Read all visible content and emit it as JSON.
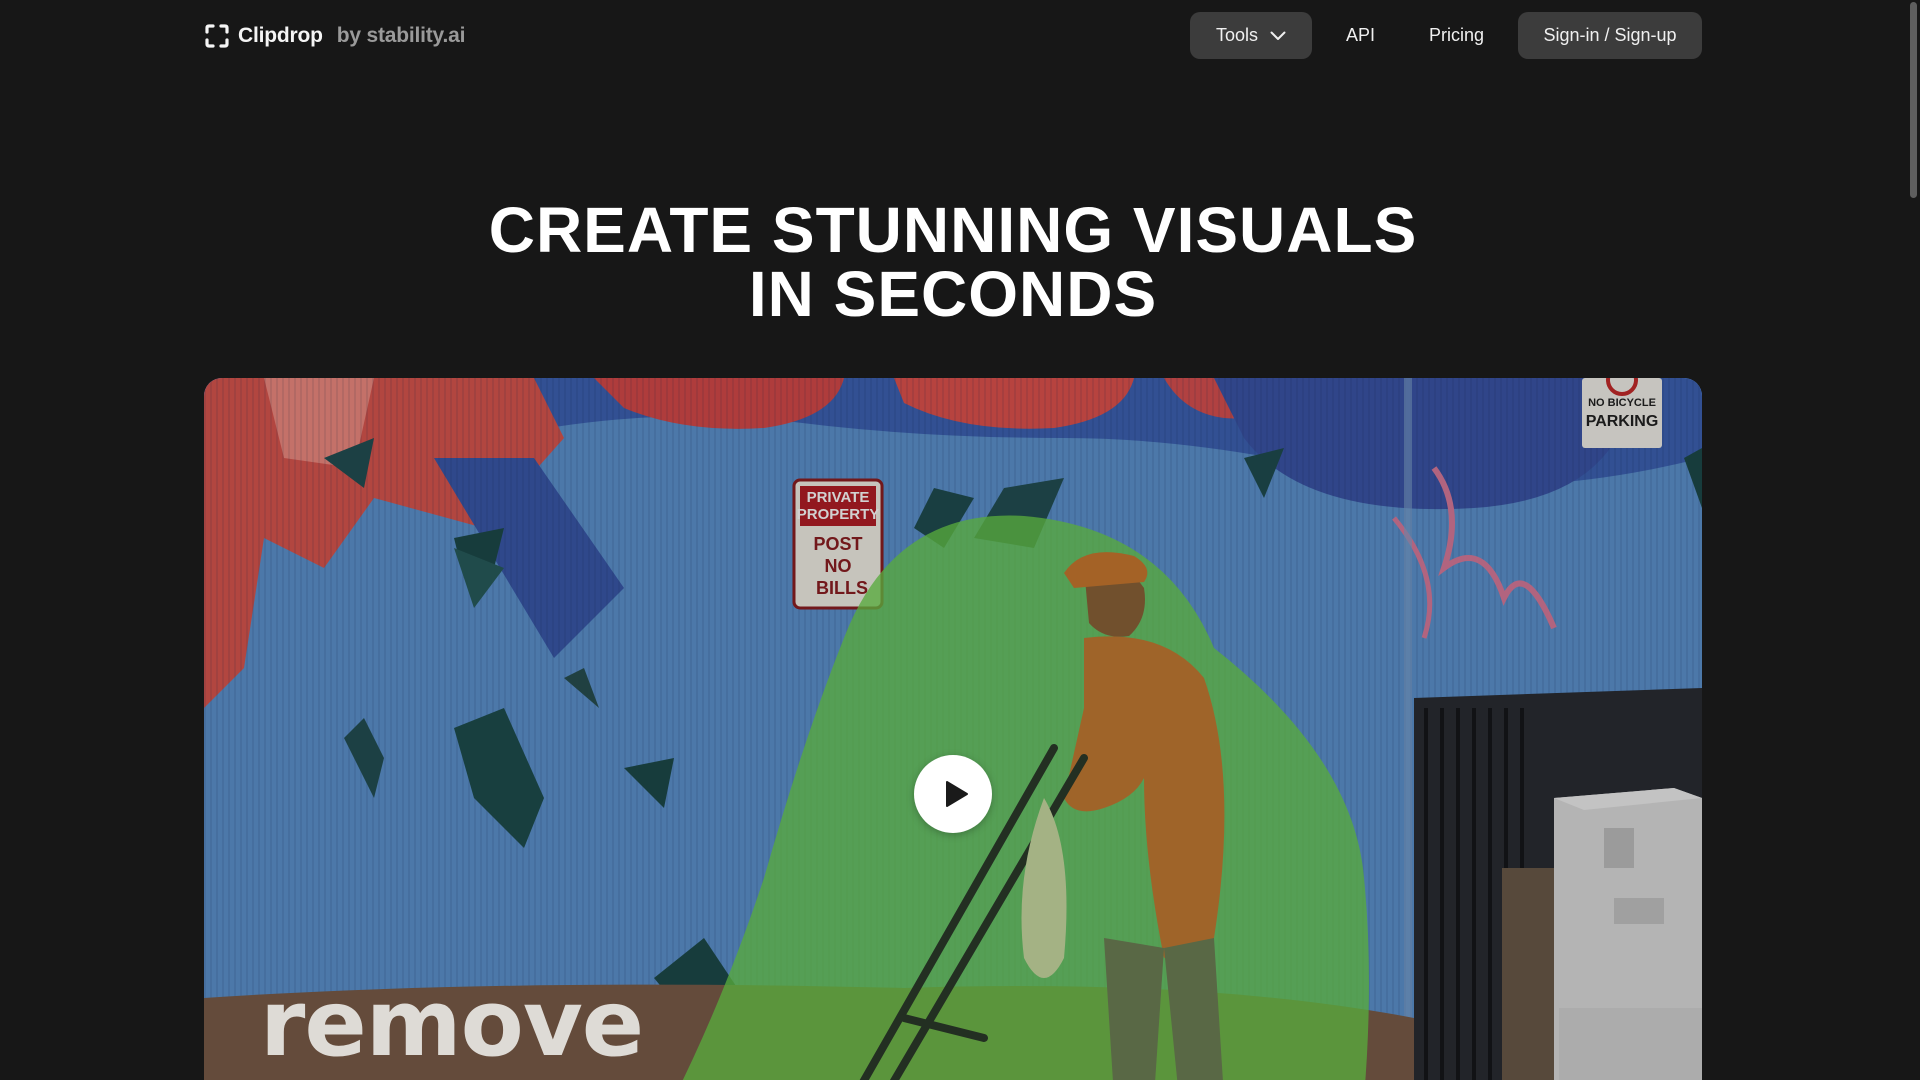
{
  "brand": {
    "name": "Clipdrop",
    "by": "by stability.ai",
    "icon": "clipdrop-logo-icon"
  },
  "nav": {
    "tools_label": "Tools",
    "tools_icon": "chevron-down-icon",
    "api_label": "API",
    "pricing_label": "Pricing",
    "signin_label": "Sign-in / Sign-up"
  },
  "hero": {
    "title_line1": "CREATE STUNNING VISUALS",
    "title_line2": "IN SECONDS"
  },
  "video": {
    "caption": "remove",
    "play_icon": "play-icon",
    "sign_private_line1": "PRIVATE",
    "sign_private_line2": "PROPERTY",
    "sign_private_line3": "POST",
    "sign_private_line4": "NO",
    "sign_private_line5": "BILLS",
    "sign_parking_line1": "NO BICYCLE",
    "sign_parking_line2": "PARKING"
  },
  "colors": {
    "background": "#171717",
    "pill": "#3c3c3c",
    "text": "#ffffff",
    "muted": "#9a9a9a",
    "mask_green": "#6ccf4a"
  }
}
